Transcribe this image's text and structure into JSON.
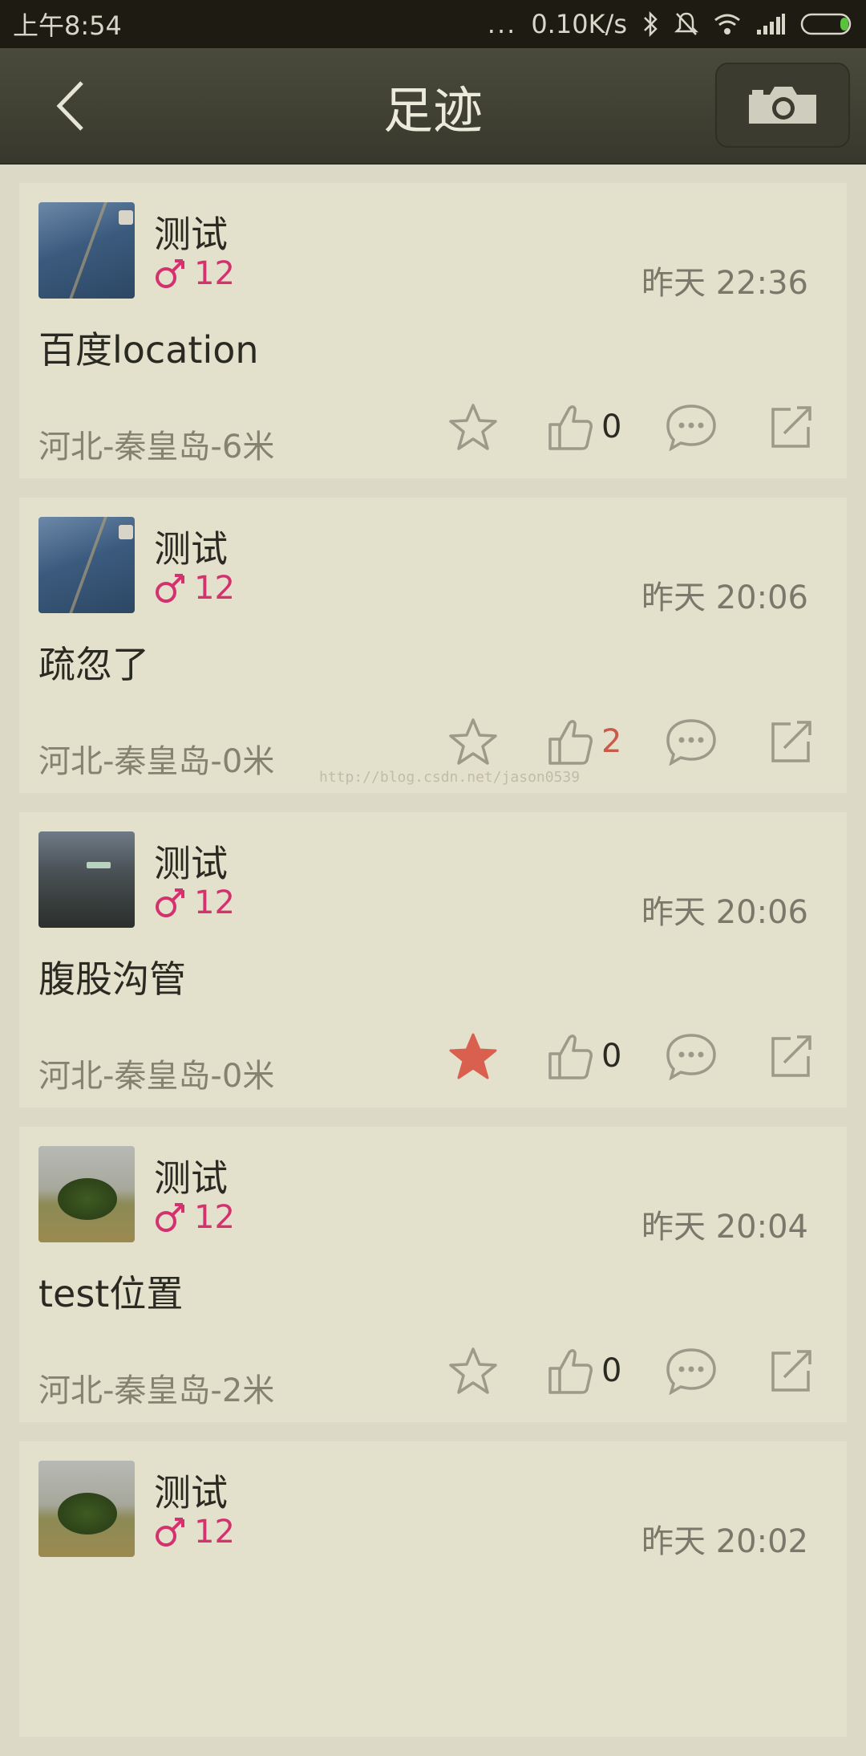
{
  "status_bar": {
    "time": "上午8:54",
    "network_speed": "0.10K/s",
    "dots": "...",
    "icons": [
      "bluetooth-icon",
      "mute-icon",
      "wifi-icon",
      "signal-icon",
      "battery-icon"
    ]
  },
  "app_bar": {
    "title": "足迹",
    "back_icon": "back-arrow-icon",
    "camera_icon": "camera-icon"
  },
  "colors": {
    "accent_pink": "#d4326e",
    "favorite_active": "#d9604f",
    "like_hot": "#c85a4a"
  },
  "posts": [
    {
      "username": "测试",
      "gender_icon": "male-icon",
      "age": "12",
      "time": "昨天 22:36",
      "content": "百度location",
      "location": "河北-秦皇岛-6米",
      "likes": "0",
      "favorited": false,
      "avatar": "denim"
    },
    {
      "username": "测试",
      "gender_icon": "male-icon",
      "age": "12",
      "time": "昨天 20:06",
      "content": "疏忽了",
      "location": "河北-秦皇岛-0米",
      "likes": "2",
      "favorited": false,
      "avatar": "denim"
    },
    {
      "username": "测试",
      "gender_icon": "male-icon",
      "age": "12",
      "time": "昨天 20:06",
      "content": "腹股沟管",
      "location": "河北-秦皇岛-0米",
      "likes": "0",
      "favorited": true,
      "avatar": "dark"
    },
    {
      "username": "测试",
      "gender_icon": "male-icon",
      "age": "12",
      "time": "昨天 20:04",
      "content": "test位置",
      "location": "河北-秦皇岛-2米",
      "likes": "0",
      "favorited": false,
      "avatar": "tree"
    },
    {
      "username": "测试",
      "gender_icon": "male-icon",
      "age": "12",
      "time": "昨天 20:02",
      "content": "",
      "location": "",
      "likes": "",
      "favorited": false,
      "avatar": "tree"
    }
  ],
  "watermark": "http://blog.csdn.net/jason0539"
}
